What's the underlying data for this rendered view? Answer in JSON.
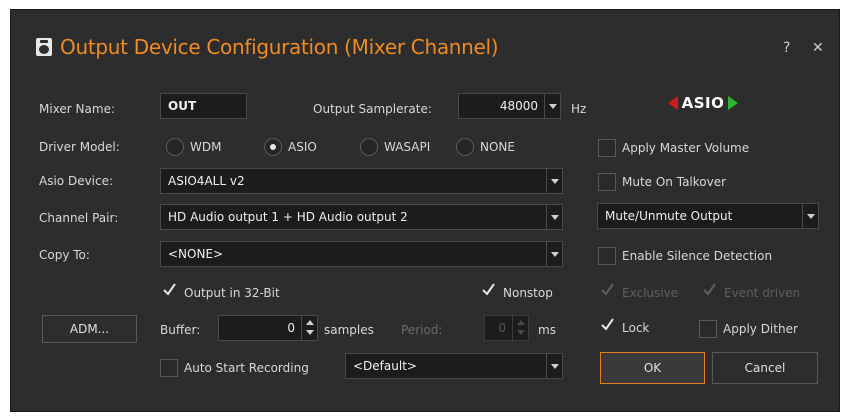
{
  "window": {
    "title": "Output Device Configuration (Mixer Channel)",
    "help_label": "?",
    "close_label": "✕"
  },
  "mixer_name": {
    "label": "Mixer Name:",
    "value": "OUT"
  },
  "samplerate": {
    "label": "Output Samplerate:",
    "value": "48000",
    "unit": "Hz"
  },
  "logo_text": "ASIO",
  "driver_model": {
    "label": "Driver Model:",
    "options": [
      "WDM",
      "ASIO",
      "WASAPI",
      "NONE"
    ],
    "selected": "ASIO"
  },
  "asio_device": {
    "label": "Asio Device:",
    "value": "ASIO4ALL v2"
  },
  "channel_pair": {
    "label": "Channel Pair:",
    "value": "HD Audio output 1 + HD Audio output 2"
  },
  "copy_to": {
    "label": "Copy To:",
    "value": "<NONE>"
  },
  "right_panel": {
    "apply_master_volume": {
      "label": "Apply Master Volume",
      "checked": false
    },
    "mute_on_talkover": {
      "label": "Mute On Talkover",
      "checked": false
    },
    "mute_select": {
      "value": "Mute/Unmute Output"
    },
    "enable_silence_detection": {
      "label": "Enable Silence Detection",
      "checked": false
    },
    "exclusive": {
      "label": "Exclusive",
      "checked": true,
      "enabled": false
    },
    "event_driven": {
      "label": "Event driven",
      "checked": true,
      "enabled": false
    },
    "lock": {
      "label": "Lock",
      "checked": true
    },
    "apply_dither": {
      "label": "Apply Dither",
      "checked": false
    }
  },
  "output_32bit": {
    "label": "Output in 32-Bit",
    "checked": true
  },
  "nonstop": {
    "label": "Nonstop",
    "checked": true
  },
  "adm_button": "ADM...",
  "buffer": {
    "label": "Buffer:",
    "value": "0",
    "unit": "samples"
  },
  "period": {
    "label": "Period:",
    "value": "0",
    "unit": "ms"
  },
  "auto_start_recording": {
    "label": "Auto Start Recording",
    "checked": false
  },
  "recording_target": {
    "value": "<Default>"
  },
  "buttons": {
    "ok": "OK",
    "cancel": "Cancel"
  },
  "colors": {
    "title": "#f08a24",
    "background": "#2d2d2d",
    "accent": "#e87f1e"
  },
  "icons": {
    "title": "speaker-icon",
    "check": "checkmark-icon"
  }
}
